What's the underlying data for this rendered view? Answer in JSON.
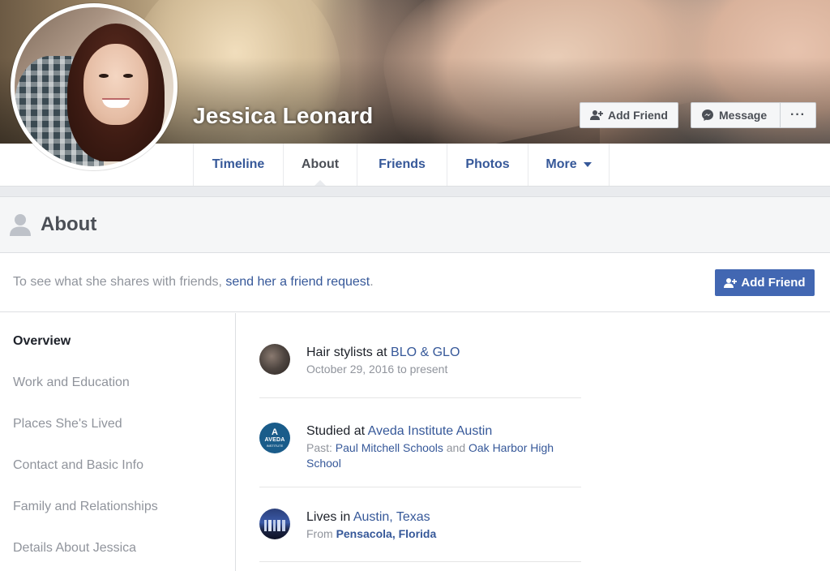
{
  "profile": {
    "name": "Jessica Leonard"
  },
  "cover_buttons": {
    "add_friend": "Add Friend",
    "message": "Message",
    "more": "···"
  },
  "nav": {
    "tabs": [
      {
        "label": "Timeline",
        "active": false
      },
      {
        "label": "About",
        "active": true
      },
      {
        "label": "Friends",
        "active": false
      },
      {
        "label": "Photos",
        "active": false
      },
      {
        "label": "More",
        "active": false
      }
    ]
  },
  "about": {
    "title": "About",
    "friend_prompt": "To see what she shares with friends, ",
    "friend_prompt_link": "send her a friend request",
    "friend_prompt_end": ".",
    "add_friend_button": "Add Friend"
  },
  "sidebar": {
    "items": [
      {
        "label": "Overview",
        "active": true
      },
      {
        "label": "Work and Education",
        "active": false
      },
      {
        "label": "Places She's Lived",
        "active": false
      },
      {
        "label": "Contact and Basic Info",
        "active": false
      },
      {
        "label": "Family and Relationships",
        "active": false
      },
      {
        "label": "Details About Jessica",
        "active": false
      }
    ]
  },
  "overview": {
    "work": {
      "prefix": "Hair stylists at ",
      "link": "BLO & GLO",
      "sub": "October 29, 2016 to present"
    },
    "education": {
      "prefix": "Studied at ",
      "link": "Aveda Institute Austin",
      "sub_prefix": "Past: ",
      "past_1": "Paul Mitchell Schools",
      "sub_and": " and ",
      "past_2": "Oak Harbor High School",
      "logo_top": "A",
      "logo_main": "AVEDA",
      "logo_sub": "INSTITUTE"
    },
    "lives": {
      "prefix": "Lives in ",
      "link": "Austin, Texas",
      "sub_prefix": "From ",
      "from_link": "Pensacola, Florida"
    }
  },
  "colors": {
    "link": "#365899",
    "primary_button": "#4267b2",
    "muted_text": "#90949c"
  }
}
